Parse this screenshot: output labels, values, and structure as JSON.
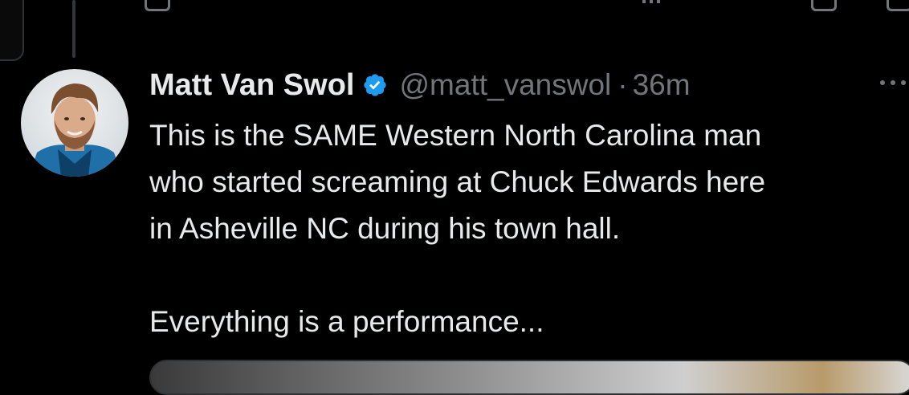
{
  "tweet": {
    "author": {
      "name": "Matt Van Swol",
      "handle": "@matt_vanswol",
      "verified": true
    },
    "separator": "·",
    "timestamp": "36m",
    "text_lines": [
      "This is the SAME Western North Carolina man",
      "who started screaming at Chuck Edwards here",
      "in Asheville NC during his town hall."
    ],
    "text_second_paragraph": "Everything is a performance..."
  },
  "icons": {
    "verified": "verified-badge-icon",
    "more": "more-options-icon"
  },
  "colors": {
    "background": "#000000",
    "text_primary": "#e7e9ea",
    "text_secondary": "#71767b",
    "verified_blue": "#1d9bf0",
    "border": "#2f3336"
  }
}
